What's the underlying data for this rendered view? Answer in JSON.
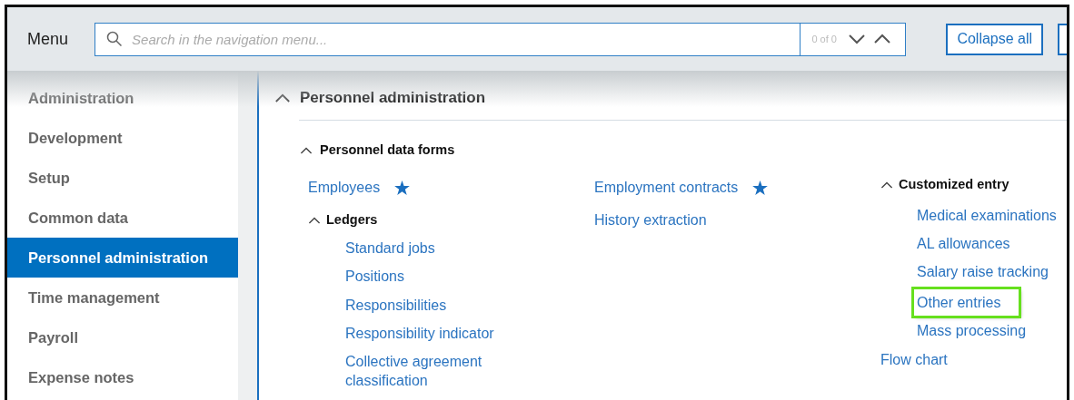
{
  "header": {
    "title": "Menu",
    "search": {
      "placeholder": "Search in the navigation menu...",
      "count": "0 of 0"
    },
    "buttons": [
      "Collapse all"
    ]
  },
  "sidebar": {
    "items": [
      {
        "label": "Administration",
        "selected": false
      },
      {
        "label": "Development",
        "selected": false
      },
      {
        "label": "Setup",
        "selected": false
      },
      {
        "label": "Common data",
        "selected": false
      },
      {
        "label": "Personnel administration",
        "selected": true
      },
      {
        "label": "Time management",
        "selected": false
      },
      {
        "label": "Payroll",
        "selected": false
      },
      {
        "label": "Expense notes",
        "selected": false
      }
    ]
  },
  "section": {
    "title": "Personnel administration",
    "expanded": true,
    "subsection": {
      "title": "Personnel data forms",
      "expanded": true,
      "columns": [
        {
          "items": [
            {
              "kind": "link",
              "label": "Employees",
              "favorite": true,
              "highlighted": false
            },
            {
              "kind": "group",
              "label": "Ledgers",
              "expanded": true,
              "children": [
                {
                  "label": "Standard jobs",
                  "highlighted": false
                },
                {
                  "label": "Positions",
                  "highlighted": false
                },
                {
                  "label": "Responsibilities",
                  "highlighted": false
                },
                {
                  "label": "Responsibility indicator",
                  "highlighted": false
                },
                {
                  "label": "Collective agreement classification",
                  "highlighted": false
                }
              ]
            }
          ]
        },
        {
          "items": [
            {
              "kind": "link",
              "label": "Employment contracts",
              "favorite": true,
              "highlighted": false
            },
            {
              "kind": "link",
              "label": "History extraction",
              "favorite": false,
              "highlighted": false
            }
          ]
        },
        {
          "items": [
            {
              "kind": "group",
              "label": "Customized entry",
              "expanded": true,
              "children": [
                {
                  "label": "Medical examinations",
                  "highlighted": false
                },
                {
                  "label": "AL allowances",
                  "highlighted": false
                },
                {
                  "label": "Salary raise tracking",
                  "highlighted": false
                },
                {
                  "label": "Other entries",
                  "highlighted": true
                },
                {
                  "label": "Mass processing",
                  "highlighted": false
                }
              ]
            },
            {
              "kind": "link",
              "label": "Flow chart",
              "favorite": false,
              "highlighted": false
            }
          ]
        }
      ]
    }
  }
}
